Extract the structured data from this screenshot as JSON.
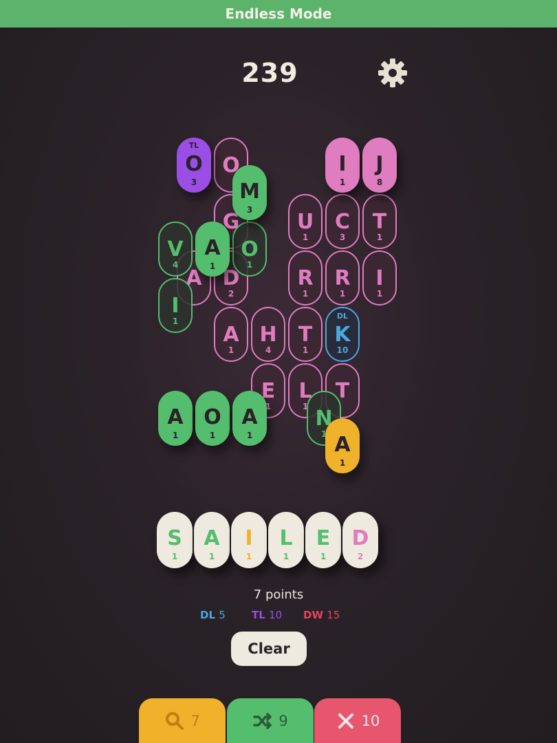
{
  "header": {
    "title": "Endless Mode"
  },
  "score": "239",
  "board": {
    "tiles": [
      {
        "letter": "O",
        "value": "",
        "mult": ""
      },
      {
        "letter": "G",
        "value": "",
        "mult": ""
      },
      {
        "letter": "A",
        "value": "",
        "mult": ""
      },
      {
        "letter": "D",
        "value": "2",
        "mult": ""
      },
      {
        "letter": "U",
        "value": "1",
        "mult": ""
      },
      {
        "letter": "C",
        "value": "3",
        "mult": ""
      },
      {
        "letter": "T",
        "value": "1",
        "mult": ""
      },
      {
        "letter": "R",
        "value": "1",
        "mult": ""
      },
      {
        "letter": "R",
        "value": "1",
        "mult": ""
      },
      {
        "letter": "I",
        "value": "1",
        "mult": ""
      },
      {
        "letter": "A",
        "value": "1",
        "mult": ""
      },
      {
        "letter": "H",
        "value": "4",
        "mult": ""
      },
      {
        "letter": "T",
        "value": "1",
        "mult": ""
      },
      {
        "letter": "E",
        "value": "1",
        "mult": ""
      },
      {
        "letter": "L",
        "value": "1",
        "mult": ""
      },
      {
        "letter": "T",
        "value": "",
        "mult": ""
      },
      {
        "letter": "O",
        "value": "3",
        "mult": "TL"
      },
      {
        "letter": "I",
        "value": "1",
        "mult": ""
      },
      {
        "letter": "J",
        "value": "8",
        "mult": ""
      },
      {
        "letter": "V",
        "value": "4",
        "mult": ""
      },
      {
        "letter": "O",
        "value": "1",
        "mult": ""
      },
      {
        "letter": "I",
        "value": "1",
        "mult": ""
      },
      {
        "letter": "N",
        "value": "1",
        "mult": ""
      },
      {
        "letter": "K",
        "value": "10",
        "mult": "DL"
      },
      {
        "letter": "M",
        "value": "3",
        "mult": ""
      },
      {
        "letter": "A",
        "value": "1",
        "mult": ""
      },
      {
        "letter": "A",
        "value": "1",
        "mult": ""
      },
      {
        "letter": "O",
        "value": "1",
        "mult": ""
      },
      {
        "letter": "A",
        "value": "1",
        "mult": ""
      },
      {
        "letter": "A",
        "value": "1",
        "mult": ""
      }
    ]
  },
  "word": {
    "letters": [
      {
        "letter": "S",
        "value": "1",
        "color": "#54be6e"
      },
      {
        "letter": "A",
        "value": "1",
        "color": "#54be6e"
      },
      {
        "letter": "I",
        "value": "1",
        "color": "#f0b22a"
      },
      {
        "letter": "L",
        "value": "1",
        "color": "#54be6e"
      },
      {
        "letter": "E",
        "value": "1",
        "color": "#54be6e"
      },
      {
        "letter": "D",
        "value": "2",
        "color": "#e07cc0"
      }
    ],
    "points_text": "7 points"
  },
  "bonuses": {
    "dl": {
      "label": "DL",
      "value": "5",
      "color": "#4aa8e0"
    },
    "tl": {
      "label": "TL",
      "value": "10",
      "color": "#9a4ee6"
    },
    "dw": {
      "label": "DW",
      "value": "15",
      "color": "#e8425e"
    }
  },
  "clear_label": "Clear",
  "bottom_bar": {
    "search": {
      "count": "7",
      "color": "#f0b22a"
    },
    "shuffle": {
      "count": "9",
      "color": "#54be6e"
    },
    "remove": {
      "count": "10",
      "color": "#e8566e"
    }
  }
}
